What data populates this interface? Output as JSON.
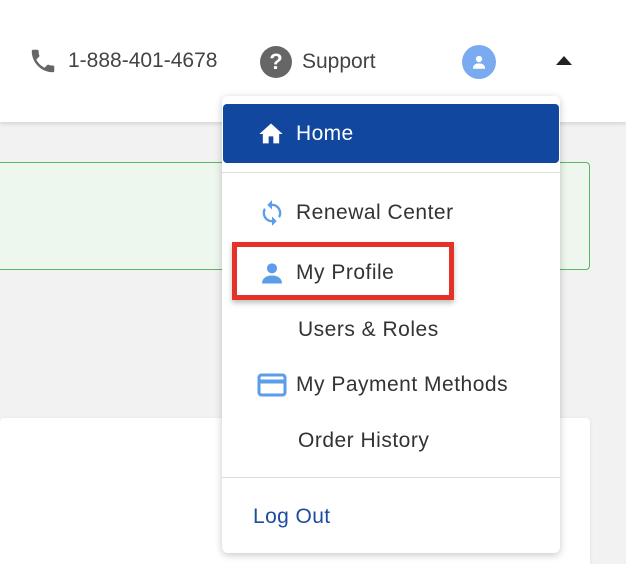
{
  "header": {
    "phone_number": "1-888-401-4678",
    "support_label": "Support",
    "support_icon": "?"
  },
  "menu": {
    "home_label": "Home",
    "items": [
      {
        "label": "Renewal Center",
        "icon": "refresh-icon"
      },
      {
        "label": "My Profile",
        "icon": "person-icon"
      },
      {
        "label": "Users & Roles",
        "icon": ""
      },
      {
        "label": "My Payment Methods",
        "icon": "credit-card-icon"
      },
      {
        "label": "Order History",
        "icon": ""
      }
    ],
    "logout_label": "Log Out"
  },
  "colors": {
    "primary": "#11479e",
    "link": "#1c4d9e",
    "highlight": "#e53228",
    "icon_blue": "#5b9de8",
    "avatar": "#7aaaf0",
    "alert_border": "#5cb85c"
  }
}
